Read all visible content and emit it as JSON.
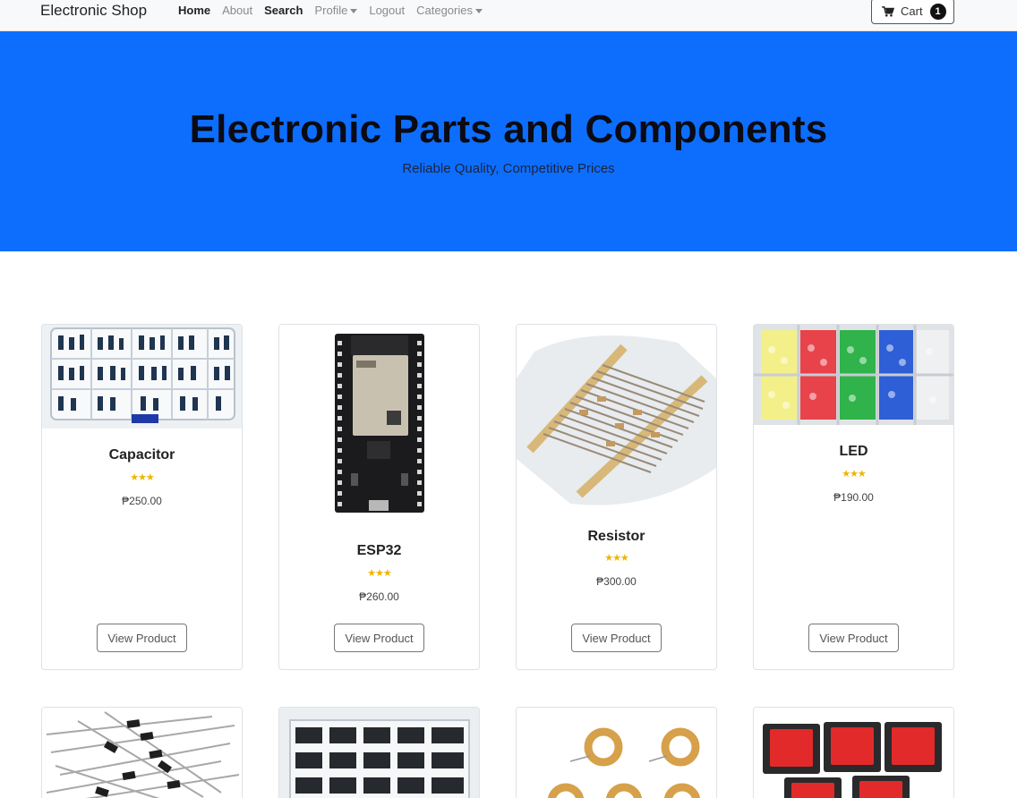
{
  "navbar": {
    "brand": "Electronic Shop",
    "links": [
      {
        "label": "Home"
      },
      {
        "label": "About"
      },
      {
        "label": "Search"
      },
      {
        "label": "Profile"
      },
      {
        "label": "Logout"
      },
      {
        "label": "Categories"
      }
    ],
    "cart_label": "Cart",
    "cart_count": "1"
  },
  "hero": {
    "title": "Electronic Parts and Components",
    "subtitle": "Reliable Quality, Competitive Prices"
  },
  "products": [
    {
      "name": "Capacitor",
      "price": "₱250.00",
      "rating": 3,
      "stars": "★★★",
      "button": "View Product"
    },
    {
      "name": "ESP32",
      "price": "₱260.00",
      "rating": 3,
      "stars": "★★★",
      "button": "View Product"
    },
    {
      "name": "Resistor",
      "price": "₱300.00",
      "rating": 3,
      "stars": "★★★",
      "button": "View Product"
    },
    {
      "name": "LED",
      "price": "₱190.00",
      "rating": 3,
      "stars": "★★★",
      "button": "View Product"
    }
  ],
  "colors": {
    "hero_bg": "#0d6efd",
    "star": "#f0b400"
  }
}
